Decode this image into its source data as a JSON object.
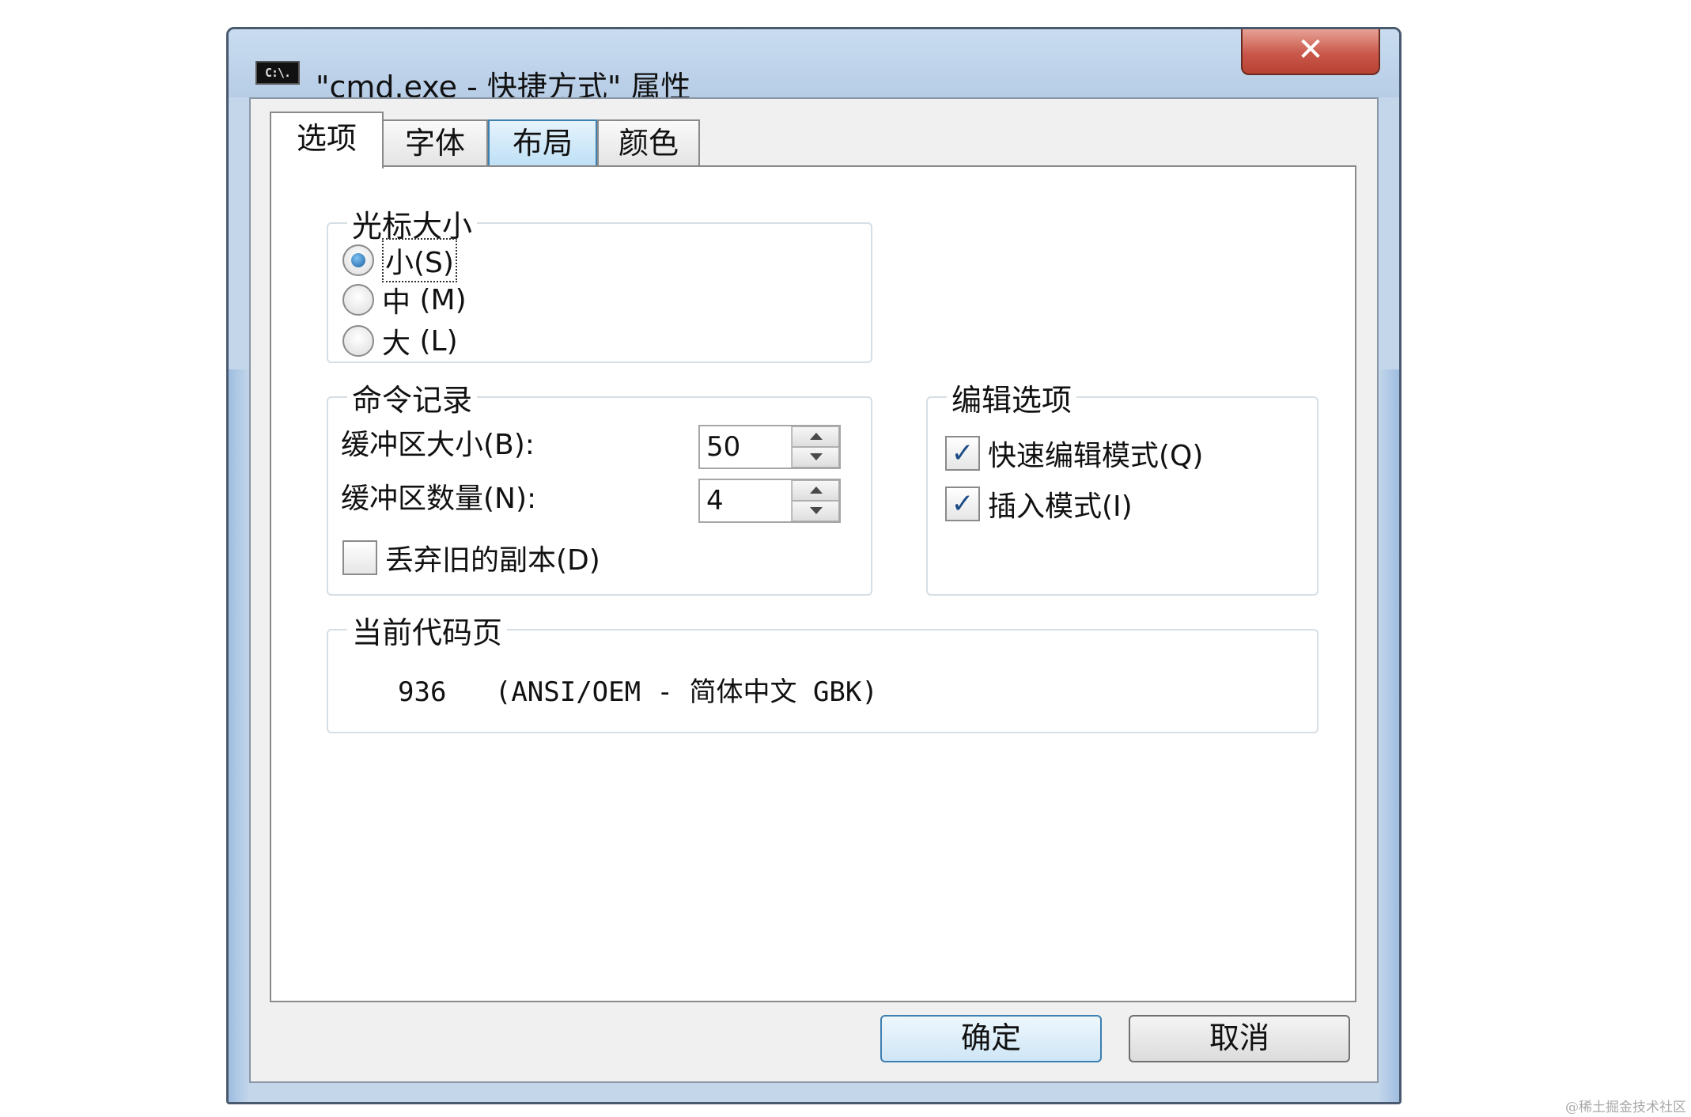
{
  "window": {
    "icon_label": "C:\\.",
    "title": "\"cmd.exe - 快捷方式\" 属性",
    "close_glyph": "✕"
  },
  "tabs": [
    {
      "label": "选项",
      "active": true
    },
    {
      "label": "字体",
      "active": false
    },
    {
      "label": "布局",
      "active": false
    },
    {
      "label": "颜色",
      "active": false
    }
  ],
  "cursor_size": {
    "title": "光标大小",
    "options": [
      {
        "label": "小",
        "mnemonic": "(S)",
        "selected": true
      },
      {
        "label": "中",
        "mnemonic": "(M)",
        "selected": false
      },
      {
        "label": "大",
        "mnemonic": "(L)",
        "selected": false
      }
    ]
  },
  "command_history": {
    "title": "命令记录",
    "buffer_size_label": "缓冲区大小(B):",
    "buffer_size_value": "50",
    "buffer_count_label": "缓冲区数量(N):",
    "buffer_count_value": "4",
    "discard_label": "丢弃旧的副本(D)",
    "discard_checked": false
  },
  "edit_options": {
    "title": "编辑选项",
    "quick_edit_label": "快速编辑模式(Q)",
    "quick_edit_checked": true,
    "insert_mode_label": "插入模式(I)",
    "insert_mode_checked": true
  },
  "code_page": {
    "title": "当前代码页",
    "number": "936",
    "description": "(ANSI/OEM - 简体中文 GBK)"
  },
  "buttons": {
    "ok_label": "确定",
    "cancel_label": "取消"
  },
  "check_glyph": "✓",
  "watermark": "@稀土掘金技术社区",
  "colors": {
    "title_bar": "#c3d6ea",
    "close_button": "#c9584a",
    "selected_radio": "#1d5f9e",
    "check_mark": "#1c4c86"
  }
}
